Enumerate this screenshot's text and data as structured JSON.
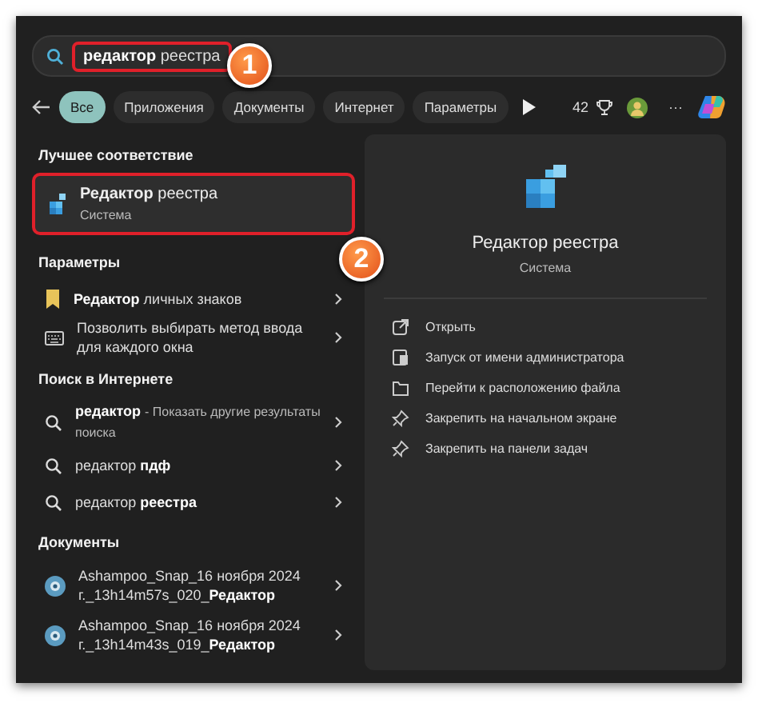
{
  "search": {
    "value": "**редактор** реестра",
    "outlined": true,
    "annotation": "1"
  },
  "filters": {
    "tabs": [
      {
        "label": "Все",
        "selected": true
      },
      {
        "label": "Приложения",
        "selected": false
      },
      {
        "label": "Документы",
        "selected": false
      },
      {
        "label": "Интернет",
        "selected": false
      },
      {
        "label": "Параметры",
        "selected": false
      }
    ],
    "points": "42",
    "overflow": "···"
  },
  "best_match": {
    "heading": "Лучшее соответствие",
    "title": "**Редактор** реестра",
    "subtitle": "Система",
    "selected": true,
    "outlined": true,
    "annotation": "2"
  },
  "sections": [
    {
      "heading": "Параметры",
      "items": [
        {
          "kind": "glyph",
          "text": "**Редактор** личных знаков"
        },
        {
          "kind": "keyboard",
          "text": "Позволить выбирать метод ввода для каждого окна"
        }
      ]
    },
    {
      "heading": "Поиск в Интернете",
      "items": [
        {
          "kind": "web",
          "text": "**редактор**",
          "note": "- Показать другие результаты поиска"
        },
        {
          "kind": "web",
          "text": "редактор **пдф**"
        },
        {
          "kind": "web",
          "text": "редактор **реестра**"
        }
      ]
    },
    {
      "heading": "Документы",
      "items": [
        {
          "kind": "document",
          "text": "Ashampoo_Snap_16 ноября 2024 г._13h14m57s_020_**Редактор**"
        },
        {
          "kind": "document",
          "text": "Ashampoo_Snap_16 ноября 2024 г._13h14m43s_019_**Редактор**"
        }
      ]
    }
  ],
  "detail": {
    "title": "Редактор реестра",
    "subtitle": "Система",
    "actions": [
      {
        "kind": "open",
        "label": "Открыть"
      },
      {
        "kind": "admin",
        "label": "Запуск от имени администратора"
      },
      {
        "kind": "folder",
        "label": "Перейти к расположению файла"
      },
      {
        "kind": "pin",
        "label": "Закрепить на начальном экране"
      },
      {
        "kind": "pin",
        "label": "Закрепить на панели задач"
      }
    ]
  }
}
